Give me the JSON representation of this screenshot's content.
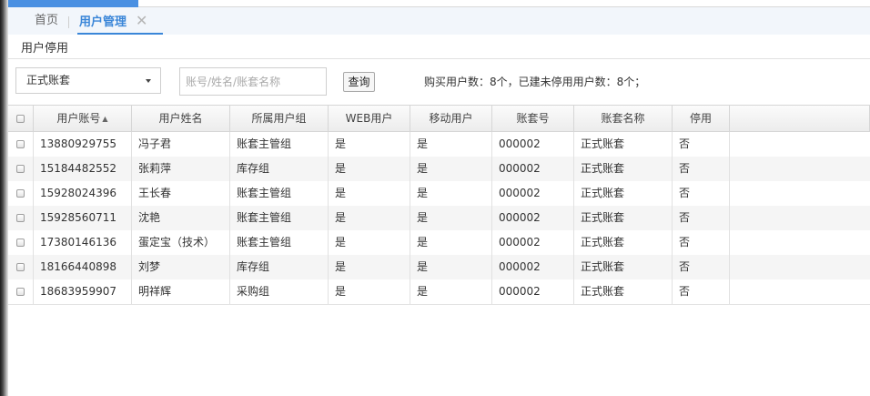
{
  "tabs": [
    {
      "label": "首页",
      "active": false
    },
    {
      "label": "用户管理",
      "active": true
    }
  ],
  "tab_close": "✕",
  "breadcrumb": "用户停用",
  "filter": {
    "account_set_selected": "正式账套",
    "search_placeholder": "账号/姓名/账套名称",
    "search_value": "",
    "query_label": "查询",
    "summary": "购买用户数：8个，已建未停用用户数：8个；"
  },
  "table": {
    "columns": [
      "用户账号",
      "用户姓名",
      "所属用户组",
      "WEB用户",
      "移动用户",
      "账套号",
      "账套名称",
      "停用"
    ],
    "sort_indicator": "▲",
    "rows": [
      [
        "13880929755",
        "冯子君",
        "账套主管组",
        "是",
        "是",
        "000002",
        "正式账套",
        "否"
      ],
      [
        "15184482552",
        "张莉萍",
        "库存组",
        "是",
        "是",
        "000002",
        "正式账套",
        "否"
      ],
      [
        "15928024396",
        "王长春",
        "账套主管组",
        "是",
        "是",
        "000002",
        "正式账套",
        "否"
      ],
      [
        "15928560711",
        "沈艳",
        "账套主管组",
        "是",
        "是",
        "000002",
        "正式账套",
        "否"
      ],
      [
        "17380146136",
        "蛋定宝（技术）",
        "账套主管组",
        "是",
        "是",
        "000002",
        "正式账套",
        "否"
      ],
      [
        "18166440898",
        "刘梦",
        "库存组",
        "是",
        "是",
        "000002",
        "正式账套",
        "否"
      ],
      [
        "18683959907",
        "明祥辉",
        "采购组",
        "是",
        "是",
        "000002",
        "正式账套",
        "否"
      ]
    ]
  },
  "colors": {
    "accent": "#3a86d8",
    "top_bar": "#4a90e2",
    "tab_bar_bg": "#f2f6fb",
    "row_alt": "#f5f5f5"
  }
}
